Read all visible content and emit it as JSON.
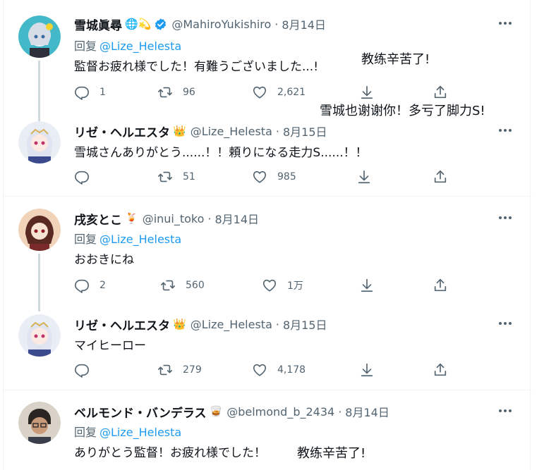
{
  "tweets": [
    {
      "name": "雪城眞尋",
      "emoji": "🌐💫",
      "handle": "@MahiroYukishiro",
      "date": "8月14日",
      "reply_label": "回复",
      "reply_to": "@Lize_Helesta",
      "text": "監督お疲れ様でした！有難うございました...!",
      "replies": "1",
      "retweets": "96",
      "likes": "2,621"
    },
    {
      "name": "リゼ・ヘルエスタ",
      "emoji": "👑",
      "handle": "@Lize_Helesta",
      "date": "8月15日",
      "text": "雪城さんありがとう......！！頼りになる走力S......！！",
      "replies": "",
      "retweets": "51",
      "likes": "985"
    },
    {
      "name": "戌亥とこ",
      "emoji": "🍹",
      "handle": "@inui_toko",
      "date": "8月14日",
      "reply_label": "回复",
      "reply_to": "@Lize_Helesta",
      "text": "おおきにね",
      "replies": "2",
      "retweets": "560",
      "likes": "1万"
    },
    {
      "name": "リゼ・ヘルエスタ",
      "emoji": "👑",
      "handle": "@Lize_Helesta",
      "date": "8月15日",
      "text": "マイヒーロー",
      "replies": "",
      "retweets": "279",
      "likes": "4,178"
    },
    {
      "name": "ベルモンド・バンデラス",
      "emoji": "🥃",
      "handle": "@belmond_b_2434",
      "date": "8月14日",
      "reply_label": "回复",
      "reply_to": "@Lize_Helesta",
      "text": "ありがとう監督！お疲れ様でした！"
    }
  ],
  "annotations": {
    "a1": "教练辛苦了!",
    "a2": "雪城也谢谢你！多亏了脚力S!",
    "a3": "教练辛苦了!"
  },
  "colors": {
    "text": "#0f1419",
    "secondary": "#536471",
    "link": "#1d9bf0",
    "verified": "#1d9bf0",
    "thread_line": "#cfd9de",
    "divider": "#eff3f4"
  }
}
